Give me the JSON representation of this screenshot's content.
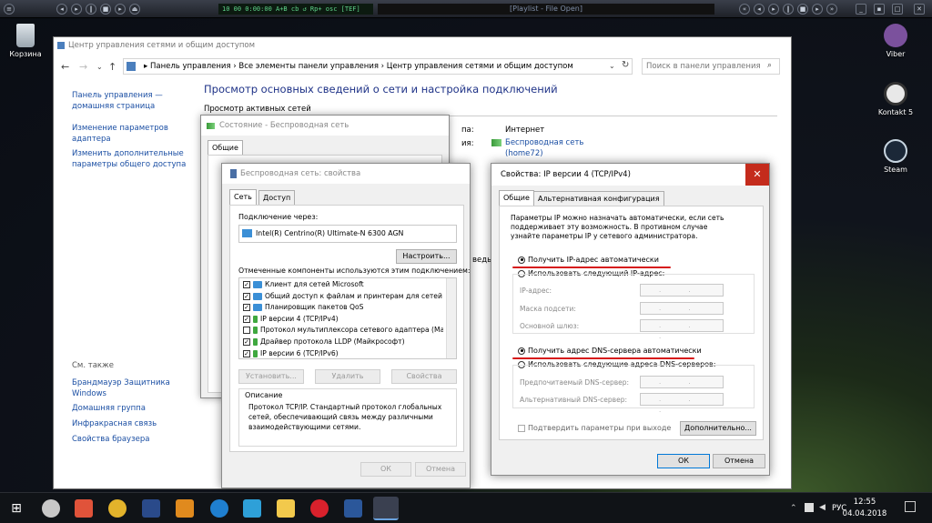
{
  "winamp": {
    "display": "10   00   0:00:00   A+B cb ↺ Rp+   osc  [TEF]",
    "title": "[Playlist - File Open]"
  },
  "desktop": {
    "recycle": "Корзина",
    "viber": "Viber",
    "kontakt": "Kontakt 5",
    "steam": "Steam"
  },
  "cp": {
    "title": "Центр управления сетями и общим доступом",
    "breadcrumb": "▸  Панель управления   ›   Все элементы панели управления   ›   Центр управления сетями и общим доступом",
    "search_placeholder": "Поиск в панели управления",
    "left_links": [
      "Панель управления — домашняя страница",
      "Изменение параметров адаптера",
      "Изменить дополнительные параметры общего доступа"
    ],
    "see_also": "См. также",
    "see_also_links": [
      "Брандмауэр Защитника Windows",
      "Домашняя группа",
      "Инфракрасная связь",
      "Свойства браузера"
    ],
    "heading": "Просмотр основных сведений о сети и настройка подключений",
    "active_networks": "Просмотр активных сетей",
    "access_type_label": "па:",
    "access_type_value": "Интернет",
    "connections_label": "ия:",
    "connection_name": "Беспроводная сеть",
    "connection_ssid": "(home72)",
    "partial_text": "ведь"
  },
  "status": {
    "title": "Состояние - Беспроводная сеть",
    "tab": "Общие"
  },
  "props": {
    "title": "Беспроводная сеть: свойства",
    "tabs": [
      "Сеть",
      "Доступ"
    ],
    "connect_using": "Подключение через:",
    "adapter": "Intel(R) Centrino(R) Ultimate-N 6300 AGN",
    "configure": "Настроить...",
    "components_label": "Отмеченные компоненты используются этим подключением:",
    "components": [
      {
        "checked": "✓",
        "label": "Клиент для сетей Microsoft"
      },
      {
        "checked": "✓",
        "label": "Общий доступ к файлам и принтерам для сетей Mi"
      },
      {
        "checked": "✓",
        "label": "Планировщик пакетов QoS"
      },
      {
        "checked": "✓",
        "label": "IP версии 4 (TCP/IPv4)"
      },
      {
        "checked": "",
        "label": "Протокол мультиплексора сетевого адаптера (Май"
      },
      {
        "checked": "✓",
        "label": "Драйвер протокола LLDP (Майкрософт)"
      },
      {
        "checked": "✓",
        "label": "IP версии 6 (TCP/IPv6)"
      }
    ],
    "install": "Установить...",
    "remove": "Удалить",
    "properties": "Свойства",
    "desc_label": "Описание",
    "desc_text": "Протокол TCP/IP. Стандартный протокол глобальных сетей, обеспечивающий связь между различными взаимодействующими сетями.",
    "ok": "ОК",
    "cancel": "Отмена"
  },
  "ipv4": {
    "title": "Свойства: IP версии 4 (TCP/IPv4)",
    "close": "✕",
    "tabs": [
      "Общие",
      "Альтернативная конфигурация"
    ],
    "intro": "Параметры IP можно назначать автоматически, если сеть поддерживает эту возможность. В противном случае узнайте параметры IP у сетевого администратора.",
    "auto_ip": "Получить IP-адрес автоматически",
    "manual_ip": "Использовать следующий IP-адрес:",
    "ip_label": "IP-адрес:",
    "mask_label": "Маска подсети:",
    "gateway_label": "Основной шлюз:",
    "auto_dns": "Получить адрес DNS-сервера автоматически",
    "manual_dns": "Использовать следующие адреса DNS-серверов:",
    "pref_dns": "Предпочитаемый DNS-сервер:",
    "alt_dns": "Альтернативный DNS-сервер:",
    "ip_placeholder": ". . .",
    "validate": "Подтвердить параметры при выходе",
    "advanced": "Дополнительно...",
    "ok": "ОК",
    "cancel": "Отмена",
    "highlight_color": "#d61a1a"
  },
  "taskbar": {
    "lang": "РУС",
    "time": "12:55",
    "date": "04.04.2018"
  }
}
